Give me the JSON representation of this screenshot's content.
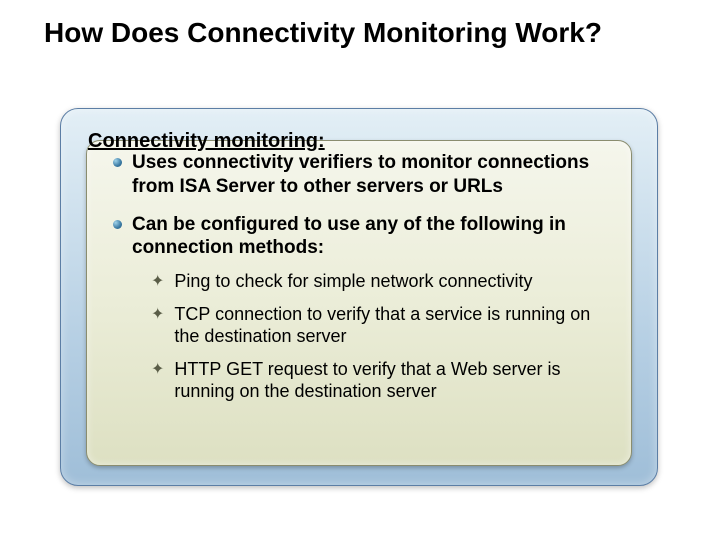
{
  "title": "How Does Connectivity Monitoring Work?",
  "subtitle": "Connectivity monitoring:",
  "bullets": [
    {
      "text": "Uses connectivity verifiers to monitor connections from ISA Server to other servers or URLs"
    },
    {
      "text": "Can be configured to use any of the following in connection methods:",
      "sub": [
        "Ping to check for simple network connectivity",
        "TCP connection to verify that a service is running on the destination server",
        "HTTP GET request to verify that a Web server is running on the destination server"
      ]
    }
  ]
}
